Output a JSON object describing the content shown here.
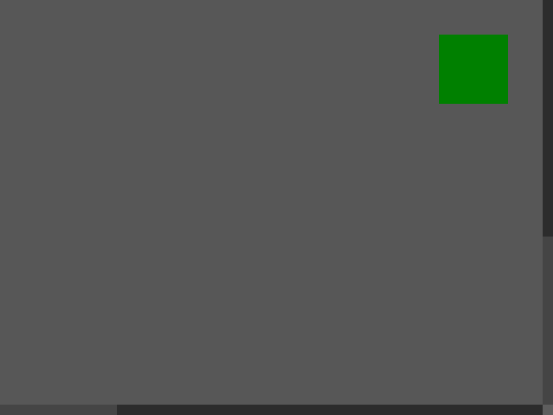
{
  "page": {
    "background_color": "#575757"
  },
  "target_square": {
    "color": "#008000"
  },
  "scrollbars": {
    "vertical": {
      "track_color": "#454545",
      "thumb_color": "#2c2c2c"
    },
    "horizontal": {
      "track_color": "#2c2c2c",
      "thumb_color": "#454545"
    },
    "corner_color": "#5e5e5e"
  }
}
